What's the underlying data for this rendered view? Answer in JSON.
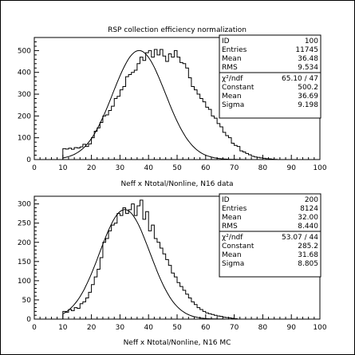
{
  "chart_data": [
    {
      "type": "histogram",
      "title": "RSP collection efficiency normalization",
      "xlabel": "Neff x Ntotal/Nonline, N16 data",
      "xlim": [
        0,
        100
      ],
      "ylim": [
        0,
        560
      ],
      "xticks": [
        "0",
        "10",
        "20",
        "30",
        "40",
        "50",
        "60",
        "70",
        "80",
        "90",
        "100"
      ],
      "yticks": [
        "0",
        "100",
        "200",
        "300",
        "400",
        "500"
      ],
      "ytick_values": [
        0,
        100,
        200,
        300,
        400,
        500
      ],
      "bin_width": 1,
      "bins_start": 10,
      "values": [
        50,
        48,
        52,
        47,
        55,
        53,
        58,
        70,
        60,
        72,
        100,
        130,
        145,
        170,
        200,
        205,
        225,
        245,
        280,
        290,
        320,
        335,
        380,
        390,
        400,
        410,
        440,
        470,
        455,
        490,
        500,
        470,
        505,
        480,
        505,
        475,
        450,
        485,
        470,
        500,
        470,
        445,
        440,
        420,
        375,
        335,
        320,
        300,
        280,
        265,
        240,
        230,
        200,
        190,
        165,
        150,
        125,
        110,
        100,
        75,
        65,
        60,
        40,
        35,
        28,
        22,
        15,
        12,
        10,
        8,
        6,
        4,
        3,
        2,
        1
      ],
      "fit": {
        "constant": 500.2,
        "mean": 36.69,
        "sigma": 9.198
      },
      "stats": [
        {
          "label": "ID",
          "value": "100"
        },
        {
          "label": "Entries",
          "value": "11745"
        },
        {
          "label": "Mean",
          "value": "36.48"
        },
        {
          "label": "RMS",
          "value": "9.534"
        }
      ],
      "fitstats": [
        {
          "label": "χ²/ndf",
          "value": "65.10   /   47"
        },
        {
          "label": "Constant",
          "value": "500.2"
        },
        {
          "label": "Mean",
          "value": "36.69"
        },
        {
          "label": "Sigma",
          "value": "9.198"
        }
      ]
    },
    {
      "type": "histogram",
      "title": "",
      "xlabel": "Neff x Ntotal/Nonline, N16 MC",
      "xlim": [
        0,
        100
      ],
      "ylim": [
        0,
        320
      ],
      "xticks": [
        "0",
        "10",
        "20",
        "30",
        "40",
        "50",
        "60",
        "70",
        "80",
        "90",
        "100"
      ],
      "yticks": [
        "0",
        "50",
        "100",
        "150",
        "200",
        "250",
        "300"
      ],
      "ytick_values": [
        0,
        50,
        100,
        150,
        200,
        250,
        300
      ],
      "bin_width": 1,
      "bins_start": 10,
      "values": [
        20,
        18,
        25,
        22,
        30,
        28,
        40,
        45,
        55,
        70,
        90,
        110,
        130,
        160,
        200,
        210,
        230,
        245,
        250,
        275,
        270,
        290,
        275,
        285,
        300,
        270,
        295,
        310,
        260,
        280,
        230,
        245,
        210,
        200,
        185,
        170,
        155,
        140,
        120,
        110,
        95,
        85,
        75,
        65,
        55,
        45,
        38,
        30,
        25,
        20,
        16,
        14,
        12,
        10,
        8,
        7,
        5,
        4,
        3,
        2,
        1
      ],
      "fit": {
        "constant": 285.2,
        "mean": 31.68,
        "sigma": 8.805
      },
      "stats": [
        {
          "label": "ID",
          "value": "200"
        },
        {
          "label": "Entries",
          "value": "8124"
        },
        {
          "label": "Mean",
          "value": "32.00"
        },
        {
          "label": "RMS",
          "value": "8.440"
        }
      ],
      "fitstats": [
        {
          "label": "χ²/ndf",
          "value": "53.07   /   44"
        },
        {
          "label": "Constant",
          "value": "285.2"
        },
        {
          "label": "Mean",
          "value": "31.68"
        },
        {
          "label": "Sigma",
          "value": "8.805"
        }
      ]
    }
  ]
}
